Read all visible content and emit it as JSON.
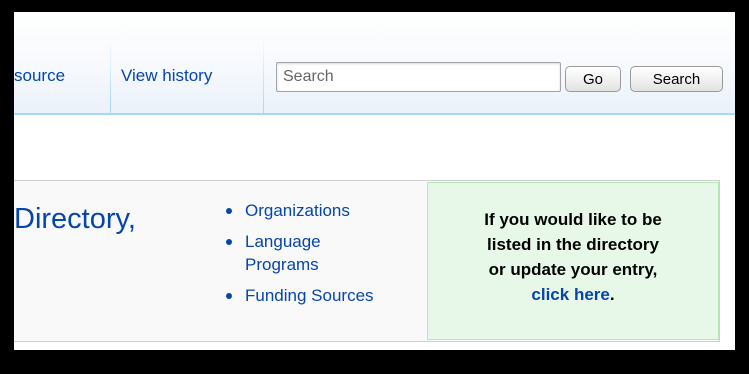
{
  "tabs": {
    "view_source": "source",
    "view_history": "View history"
  },
  "search": {
    "placeholder": "Search",
    "value": "",
    "go_label": "Go",
    "search_label": "Search"
  },
  "content": {
    "directory_title": "Directory,",
    "links": [
      {
        "label_line1": "Organizations",
        "label_line2": ""
      },
      {
        "label_line1": "Language",
        "label_line2": "Programs"
      },
      {
        "label_line1": "Funding Sources",
        "label_line2": ""
      }
    ],
    "notice": {
      "line1": "If you would like to be",
      "line2": "listed in the directory",
      "line3": "or update your entry,",
      "link_text": "click here",
      "trailing": "."
    }
  },
  "colors": {
    "link": "#0645ad",
    "notice_bg": "#e8f8e8",
    "tab_border": "#a7d7f9"
  }
}
